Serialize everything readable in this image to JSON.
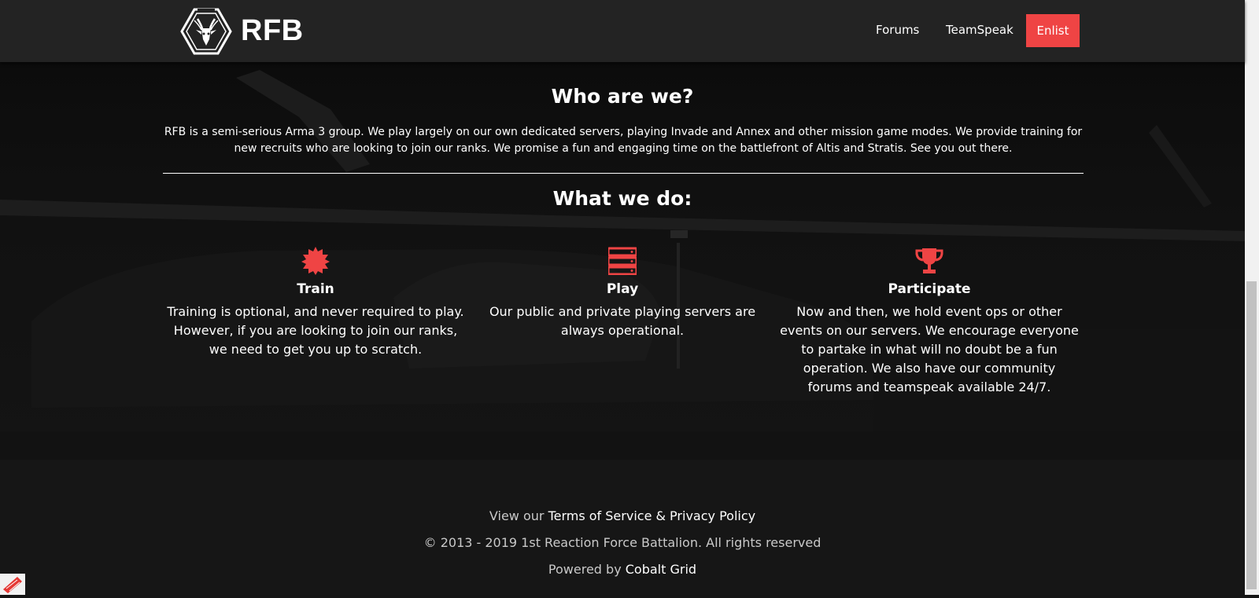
{
  "header": {
    "brand": "RFB",
    "nav": {
      "forums": "Forums",
      "teamspeak": "TeamSpeak",
      "enlist": "Enlist"
    }
  },
  "about": {
    "heading": "Who are we?",
    "text": "RFB is a semi-serious Arma 3 group. We play largely on our own dedicated servers, playing Invade and Annex and other mission game modes. We provide training for new recruits who are looking to join our ranks. We promise a fun and engaging time on the battlefront of Altis and Stratis. See you out there."
  },
  "what": {
    "heading": "What we do:",
    "features": [
      {
        "icon": "certificate-icon",
        "title": "Train",
        "text": "Training is optional, and never required to play. However, if you are looking to join our ranks, we need to get you up to scratch."
      },
      {
        "icon": "server-icon",
        "title": "Play",
        "text": "Our public and private playing servers are always operational."
      },
      {
        "icon": "trophy-icon",
        "title": "Participate",
        "text": "Now and then, we hold event ops or other events on our servers. We encourage everyone to partake in what will no doubt be a fun operation. We also have our community forums and teamspeak available 24/7."
      }
    ]
  },
  "footer": {
    "view_prefix": "View our",
    "terms_link": "Terms of Service & Privacy Policy",
    "copyright": "© 2013 - 2019 1st Reaction Force Battalion. All rights reserved",
    "powered_prefix": "Powered by",
    "powered_link": "Cobalt Grid"
  },
  "colors": {
    "accent": "#ef4444",
    "header_bg": "#232323",
    "footer_bg": "#161616"
  }
}
